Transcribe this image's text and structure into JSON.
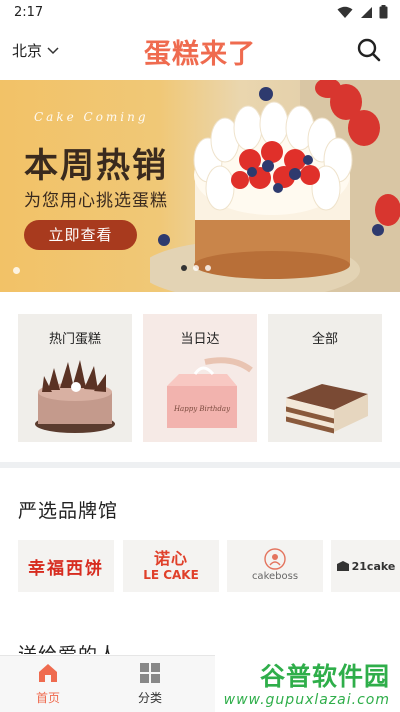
{
  "status_bar": {
    "time": "2:17"
  },
  "header": {
    "city": "北京",
    "title": "蛋糕来了"
  },
  "banner": {
    "subtitle": "Cake Coming",
    "title": "本周热销",
    "description": "为您用心挑选蛋糕",
    "button_label": "立即查看",
    "slide_count": 3,
    "active_slide": 1
  },
  "categories": [
    {
      "label": "热门蛋糕"
    },
    {
      "label": "当日达",
      "box_text": "Happy Birthday"
    },
    {
      "label": "全部"
    }
  ],
  "brand_section": {
    "title": "严选品牌馆",
    "brands": [
      {
        "name": "幸福西饼"
      },
      {
        "name": "诺心",
        "sub": "LE CAKE"
      },
      {
        "name": "cakeboss"
      },
      {
        "name": "21cake"
      }
    ]
  },
  "gift_section": {
    "title": "送给爱的人"
  },
  "bottom_nav": {
    "items": [
      {
        "label": "首页",
        "active": true
      },
      {
        "label": "分类",
        "active": false
      }
    ]
  },
  "watermark": {
    "title": "谷普软件园",
    "url": "www.gupuxlazai.com"
  },
  "colors": {
    "accent": "#ef6b4f",
    "banner_button": "#a83a1e",
    "brand_red": "#d72c20",
    "watermark_green": "#2fae4a"
  }
}
